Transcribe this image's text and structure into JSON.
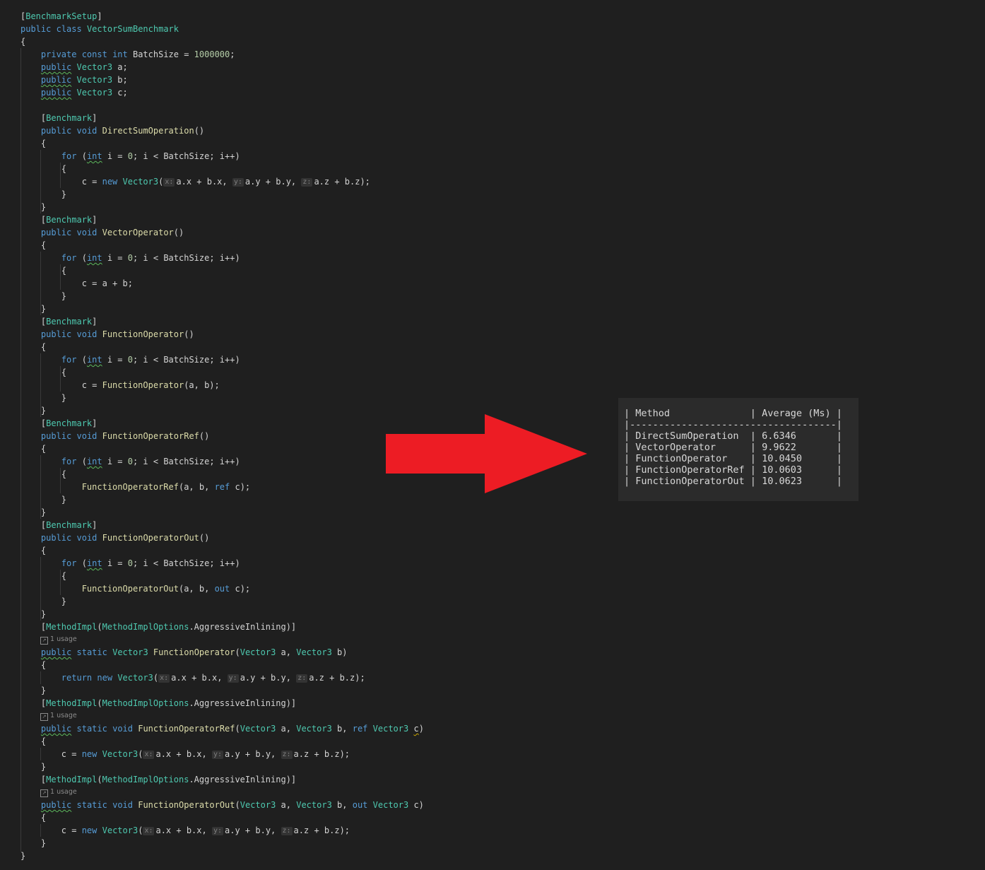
{
  "code": {
    "attr_setup": "BenchmarkSetup",
    "class_decl": {
      "public": "public",
      "class": "class",
      "name": "VectorSumBenchmark"
    },
    "const_line": {
      "mods": "private const",
      "type": "int",
      "name": "BatchSize",
      "value": "1000000"
    },
    "fields": [
      {
        "mod": "public",
        "type": "Vector3",
        "name": "a"
      },
      {
        "mod": "public",
        "type": "Vector3",
        "name": "b"
      },
      {
        "mod": "public",
        "type": "Vector3",
        "name": "c"
      }
    ],
    "benchmark_attr": "Benchmark",
    "methods": [
      {
        "name": "DirectSumOperation",
        "body": "direct"
      },
      {
        "name": "VectorOperator",
        "body": "c = a + b;"
      },
      {
        "name": "FunctionOperator",
        "body": "fcall"
      },
      {
        "name": "FunctionOperatorRef",
        "body": "refcall"
      },
      {
        "name": "FunctionOperatorOut",
        "body": "outcall"
      }
    ],
    "methodimpl_attr": "MethodImpl",
    "methodimpl_options": "MethodImplOptions",
    "aggressive": "AggressiveInlining",
    "usage_hint": "1 usage",
    "static_methods": [
      {
        "ret": "Vector3",
        "name": "FunctionOperator",
        "params": "(Vector3 a, Vector3 b)"
      },
      {
        "ret": "void",
        "name": "FunctionOperatorRef",
        "params": "(Vector3 a, Vector3 b, ref Vector3 c)"
      },
      {
        "ret": "void",
        "name": "FunctionOperatorOut",
        "params": "(Vector3 a, Vector3 b, out Vector3 c)"
      }
    ],
    "param_hints": [
      "x:",
      "y:",
      "z:"
    ]
  },
  "results_table": {
    "header": {
      "method": "Method",
      "average": "Average (Ms)"
    },
    "rows": [
      {
        "method": "DirectSumOperation",
        "average": "6.6346"
      },
      {
        "method": "VectorOperator",
        "average": "9.9622"
      },
      {
        "method": "FunctionOperator",
        "average": "10.0450"
      },
      {
        "method": "FunctionOperatorRef",
        "average": "10.0603"
      },
      {
        "method": "FunctionOperatorOut",
        "average": "10.0623"
      }
    ]
  },
  "colors": {
    "arrow": "#ed1c24",
    "editor_bg": "#1f1f1f",
    "table_bg": "#2b2b2b"
  }
}
